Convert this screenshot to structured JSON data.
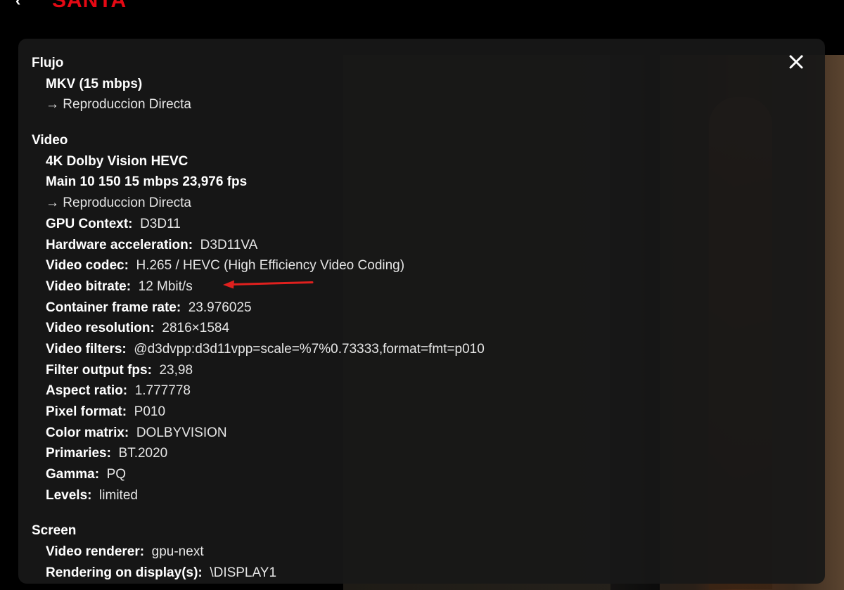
{
  "topbar": {
    "back_icon": "‹",
    "logo_text": "SANTA"
  },
  "close_icon": "close-icon",
  "sections": {
    "flujo": {
      "title": "Flujo",
      "container": "MKV (15 mbps)",
      "playback": "→ Reproduccion Directa"
    },
    "video": {
      "title": "Video",
      "format": "4K Dolby Vision HEVC",
      "profile": "Main 10 150 15 mbps 23,976 fps",
      "playback": "→ Reproduccion Directa",
      "rows": [
        {
          "key": "GPU Context:",
          "value": "D3D11"
        },
        {
          "key": "Hardware acceleration:",
          "value": "D3D11VA"
        },
        {
          "key": "Video codec:",
          "value": "H.265 / HEVC (High Efficiency Video Coding)"
        },
        {
          "key": "Video bitrate:",
          "value": "12 Mbit/s"
        },
        {
          "key": "Container frame rate:",
          "value": "23.976025"
        },
        {
          "key": "Video resolution:",
          "value": "2816×1584"
        },
        {
          "key": "Video filters:",
          "value": "@d3dvpp:d3d11vpp=scale=%7%0.73333,format=fmt=p010"
        },
        {
          "key": "Filter output fps:",
          "value": "23,98"
        },
        {
          "key": "Aspect ratio:",
          "value": "1.777778"
        },
        {
          "key": "Pixel format:",
          "value": "P010"
        },
        {
          "key": "Color matrix:",
          "value": "DOLBYVISION"
        },
        {
          "key": "Primaries:",
          "value": "BT.2020"
        },
        {
          "key": "Gamma:",
          "value": "PQ"
        },
        {
          "key": "Levels:",
          "value": "limited"
        }
      ]
    },
    "screen": {
      "title": "Screen",
      "rows": [
        {
          "key": "Video renderer:",
          "value": "gpu-next"
        },
        {
          "key": "Rendering on display(s):",
          "value": "\\DISPLAY1"
        }
      ]
    }
  },
  "colors": {
    "brand": "#e50914",
    "annotation": "#e0201e",
    "panel_bg": "#181818"
  }
}
